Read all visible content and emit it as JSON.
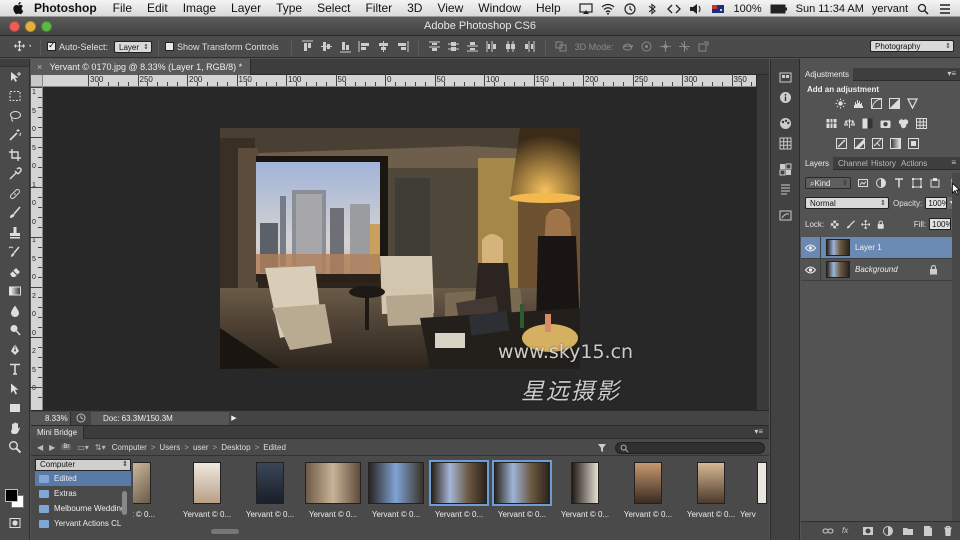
{
  "menubar": {
    "app": "Photoshop",
    "items": [
      "File",
      "Edit",
      "Image",
      "Layer",
      "Type",
      "Select",
      "Filter",
      "3D",
      "View",
      "Window",
      "Help"
    ],
    "battery": "100%",
    "clock": "Sun 11:34 AM",
    "user": "yervant"
  },
  "window": {
    "title": "Adobe Photoshop CS6"
  },
  "options": {
    "auto_select_label": "Auto-Select:",
    "auto_select_checked": true,
    "auto_select_value": "Layer",
    "show_transform_label": "Show Transform Controls",
    "mode_3d_label": "3D Mode:",
    "workspace": "Photography"
  },
  "document": {
    "tab_title": "Yervant © 0170.jpg @ 8.33% (Layer 1, RGB/8) *",
    "zoom": "8.33%",
    "doc_size": "Doc: 63.3M/150.3M",
    "ruler_top": [
      "300",
      "250",
      "200",
      "150",
      "100",
      "50",
      "0",
      "50",
      "100",
      "150",
      "200",
      "250",
      "300",
      "350",
      "400"
    ],
    "ruler_left": [
      "1",
      "5",
      "0",
      "5",
      "0",
      "1",
      "0",
      "0",
      "1",
      "5",
      "0",
      "2",
      "0",
      "0",
      "2",
      "5",
      "0"
    ],
    "watermark_url": "www.sky15.cn",
    "watermark_cn": "星远摄影"
  },
  "minibridge": {
    "title": "Mini Bridge",
    "br_label": "Br",
    "path": [
      "Computer",
      "Users",
      "user",
      "Desktop",
      "Edited"
    ],
    "location": "Computer",
    "folders": [
      {
        "name": "Edited",
        "selected": true
      },
      {
        "name": "Extras",
        "selected": false
      },
      {
        "name": "Melbourne Wedding",
        "selected": false
      },
      {
        "name": "Yervant Actions CL",
        "selected": false
      }
    ],
    "thumbnails": [
      {
        "caption": "nt © 0...",
        "selected": false
      },
      {
        "caption": "Yervant © 0...",
        "selected": false
      },
      {
        "caption": "Yervant © 0...",
        "selected": false
      },
      {
        "caption": "Yervant © 0...",
        "selected": false
      },
      {
        "caption": "Yervant © 0...",
        "selected": false
      },
      {
        "caption": "Yervant © 0...",
        "selected": true
      },
      {
        "caption": "Yervant © 0...",
        "selected": true
      },
      {
        "caption": "Yervant © 0...",
        "selected": false
      },
      {
        "caption": "Yervant © 0...",
        "selected": false
      },
      {
        "caption": "Yervant © 0...",
        "selected": false
      },
      {
        "caption": "Yerv",
        "selected": false
      }
    ]
  },
  "adjustments": {
    "tab": "Adjustments",
    "add_label": "Add an adjustment"
  },
  "layers": {
    "tabs": [
      "Layers",
      "Channel",
      "History",
      "Actions"
    ],
    "filter_kind": "Kind",
    "blend_mode": "Normal",
    "opacity_label": "Opacity:",
    "opacity": "100%",
    "lock_label": "Lock:",
    "fill_label": "Fill:",
    "fill": "100%",
    "items": [
      {
        "name": "Layer 1",
        "selected": true,
        "italic": false,
        "locked": false
      },
      {
        "name": "Background",
        "selected": false,
        "italic": true,
        "locked": true
      }
    ]
  },
  "colors": {
    "accent_selection": "#6b8ab3",
    "folder_selection": "#5a7aa6",
    "thumb_selection": "#6f9cd2"
  }
}
